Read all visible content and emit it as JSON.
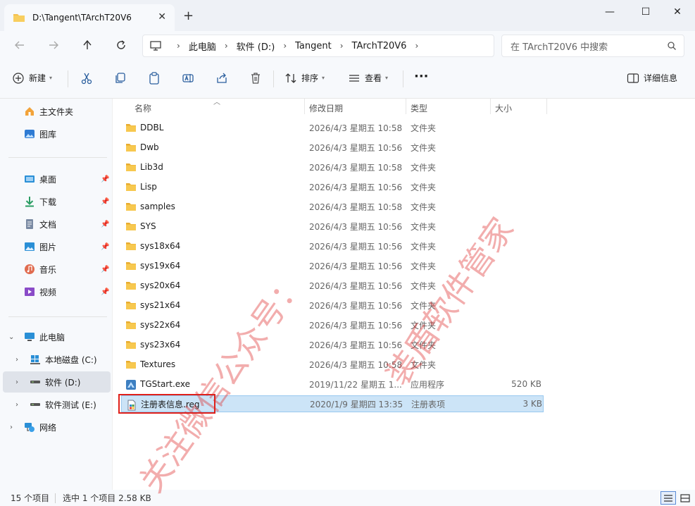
{
  "window": {
    "tab_title": "D:\\Tangent\\TArchT20V6",
    "close_tab_glyph": "✕",
    "new_tab_glyph": "+",
    "minimize_glyph": "—",
    "maximize_glyph": "☐",
    "close_glyph": "✕"
  },
  "address": {
    "crumbs": [
      "此电脑",
      "软件 (D:)",
      "Tangent",
      "TArchT20V6"
    ],
    "search_placeholder": "在 TArchT20V6 中搜索"
  },
  "toolbar": {
    "new_label": "新建",
    "sort_label": "排序",
    "view_label": "查看",
    "more_label": "···",
    "details_label": "详细信息"
  },
  "sidebar": {
    "home": "主文件夹",
    "gallery": "图库",
    "desktop": "桌面",
    "downloads": "下载",
    "documents": "文档",
    "pictures": "图片",
    "music": "音乐",
    "videos": "视频",
    "this_pc": "此电脑",
    "drive_c": "本地磁盘 (C:)",
    "drive_d": "软件 (D:)",
    "drive_e": "软件测试 (E:)",
    "network": "网络"
  },
  "columns": {
    "name": "名称",
    "date": "修改日期",
    "type": "类型",
    "size": "大小"
  },
  "files": [
    {
      "name": "DDBL",
      "date": "2026/4/3 星期五 10:58",
      "type": "文件夹",
      "size": "",
      "kind": "folder"
    },
    {
      "name": "Dwb",
      "date": "2026/4/3 星期五 10:56",
      "type": "文件夹",
      "size": "",
      "kind": "folder"
    },
    {
      "name": "Lib3d",
      "date": "2026/4/3 星期五 10:58",
      "type": "文件夹",
      "size": "",
      "kind": "folder"
    },
    {
      "name": "Lisp",
      "date": "2026/4/3 星期五 10:56",
      "type": "文件夹",
      "size": "",
      "kind": "folder"
    },
    {
      "name": "samples",
      "date": "2026/4/3 星期五 10:58",
      "type": "文件夹",
      "size": "",
      "kind": "folder"
    },
    {
      "name": "SYS",
      "date": "2026/4/3 星期五 10:56",
      "type": "文件夹",
      "size": "",
      "kind": "folder"
    },
    {
      "name": "sys18x64",
      "date": "2026/4/3 星期五 10:56",
      "type": "文件夹",
      "size": "",
      "kind": "folder"
    },
    {
      "name": "sys19x64",
      "date": "2026/4/3 星期五 10:56",
      "type": "文件夹",
      "size": "",
      "kind": "folder"
    },
    {
      "name": "sys20x64",
      "date": "2026/4/3 星期五 10:56",
      "type": "文件夹",
      "size": "",
      "kind": "folder"
    },
    {
      "name": "sys21x64",
      "date": "2026/4/3 星期五 10:56",
      "type": "文件夹",
      "size": "",
      "kind": "folder"
    },
    {
      "name": "sys22x64",
      "date": "2026/4/3 星期五 10:56",
      "type": "文件夹",
      "size": "",
      "kind": "folder"
    },
    {
      "name": "sys23x64",
      "date": "2026/4/3 星期五 10:56",
      "type": "文件夹",
      "size": "",
      "kind": "folder"
    },
    {
      "name": "Textures",
      "date": "2026/4/3 星期五 10:58",
      "type": "文件夹",
      "size": "",
      "kind": "folder"
    },
    {
      "name": "TGStart.exe",
      "date": "2019/11/22 星期五 1...",
      "type": "应用程序",
      "size": "520 KB",
      "kind": "exe"
    },
    {
      "name": "注册表信息.reg",
      "date": "2020/1/9 星期四 13:35",
      "type": "注册表项",
      "size": "3 KB",
      "kind": "reg"
    }
  ],
  "status": {
    "count": "15 个项目",
    "selection": "选中 1 个项目  2.58 KB"
  },
  "watermark": {
    "line1": "关注微信公众号：",
    "line2": "装盾软件管家"
  },
  "colors": {
    "accent": "#2b5f9e",
    "folder": "#f4c04e",
    "selection": "#cce4f7",
    "highlight_box": "#e0201a"
  }
}
